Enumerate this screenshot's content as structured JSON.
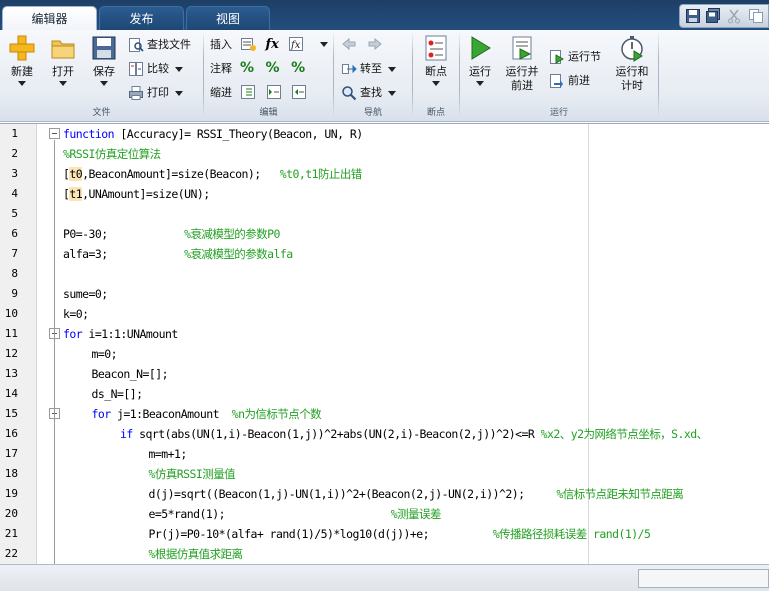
{
  "tabs": [
    {
      "label": "编辑器",
      "active": true
    },
    {
      "label": "发布",
      "active": false
    },
    {
      "label": "视图",
      "active": false
    }
  ],
  "quick_access": [
    "save-icon",
    "save-all-icon",
    "cut-icon",
    "copy-icon"
  ],
  "ribbon": {
    "file": {
      "label": "文件",
      "new": "新建",
      "open": "打开",
      "save": "保存",
      "find_files": "查找文件",
      "compare": "比较",
      "print": "打印"
    },
    "edit": {
      "label": "编辑",
      "insert": "插入",
      "comment": "注释",
      "indent": "缩进",
      "fx": "fx"
    },
    "navigate": {
      "label": "导航",
      "goto": "转至",
      "find": "查找"
    },
    "breakpoints": {
      "label": "断点",
      "breakpoints": "断点"
    },
    "run": {
      "label": "运行",
      "run": "运行",
      "run_advance_1": "运行并",
      "run_advance_2": "前进",
      "run_section": "运行节",
      "advance": "前进",
      "run_time_1": "运行和",
      "run_time_2": "计时"
    }
  },
  "accent_colors": {
    "tabbar": "#1d3f66",
    "keyword": "#0000ff",
    "comment": "#22a022",
    "highlight": "#fde4b5"
  },
  "code_lines": [
    {
      "n": "1",
      "fold": "box",
      "parts": [
        {
          "t": "function",
          "c": "kw"
        },
        {
          "t": " [Accuracy]= RSSI_Theory(Beacon, UN, R)"
        }
      ]
    },
    {
      "n": "2",
      "indent": 0,
      "parts": [
        {
          "t": "%RSSI仿真定位算法",
          "c": "cm"
        }
      ]
    },
    {
      "n": "3",
      "indent": 0,
      "parts": [
        {
          "t": "["
        },
        {
          "t": "t0",
          "c": "hl"
        },
        {
          "t": ",BeaconAmount]=size(Beacon);   "
        },
        {
          "t": "%t0,t1防止出错",
          "c": "cm"
        }
      ]
    },
    {
      "n": "4",
      "indent": 0,
      "parts": [
        {
          "t": "["
        },
        {
          "t": "t1",
          "c": "hl"
        },
        {
          "t": ",UNAmount]=size(UN);"
        }
      ]
    },
    {
      "n": "5",
      "indent": 0,
      "parts": []
    },
    {
      "n": "6",
      "indent": 0,
      "parts": [
        {
          "t": "P0=-30;            "
        },
        {
          "t": "%衰减模型的参数P0",
          "c": "cm"
        }
      ]
    },
    {
      "n": "7",
      "indent": 0,
      "parts": [
        {
          "t": "alfa=3;            "
        },
        {
          "t": "%衰减模型的参数alfa",
          "c": "cm"
        }
      ]
    },
    {
      "n": "8",
      "indent": 0,
      "parts": []
    },
    {
      "n": "9",
      "indent": 0,
      "parts": [
        {
          "t": "sume=0;"
        }
      ]
    },
    {
      "n": "10",
      "indent": 0,
      "parts": [
        {
          "t": "k=0;"
        }
      ]
    },
    {
      "n": "11",
      "fold": "box",
      "parts": [
        {
          "t": "for",
          "c": "kw"
        },
        {
          "t": " i=1:1:UNAmount"
        }
      ]
    },
    {
      "n": "12",
      "indent": 1,
      "parts": [
        {
          "t": "m=0;"
        }
      ]
    },
    {
      "n": "13",
      "indent": 1,
      "parts": [
        {
          "t": "Beacon_N=[];"
        }
      ]
    },
    {
      "n": "14",
      "indent": 1,
      "parts": [
        {
          "t": "ds_N=[];"
        }
      ]
    },
    {
      "n": "15",
      "fold": "box",
      "indent": 1,
      "parts": [
        {
          "t": "for",
          "c": "kw"
        },
        {
          "t": " j=1:BeaconAmount  "
        },
        {
          "t": "%n为信标节点个数",
          "c": "cm"
        }
      ]
    },
    {
      "n": "16",
      "indent": 2,
      "parts": [
        {
          "t": "if",
          "c": "kw"
        },
        {
          "t": " sqrt(abs(UN(1,i)-Beacon(1,j))^2+abs(UN(2,i)-Beacon(2,j))^2)<=R "
        },
        {
          "t": "%x2、y2为网络节点坐标，S.xd、",
          "c": "cm"
        }
      ]
    },
    {
      "n": "17",
      "indent": 3,
      "parts": [
        {
          "t": "m=m+1;"
        }
      ]
    },
    {
      "n": "18",
      "indent": 3,
      "parts": [
        {
          "t": "%仿真RSSI测量值",
          "c": "cm"
        }
      ]
    },
    {
      "n": "19",
      "indent": 3,
      "parts": [
        {
          "t": "d(j)=sqrt((Beacon(1,j)-UN(1,i))^2+(Beacon(2,j)-UN(2,i))^2);     "
        },
        {
          "t": "%信标节点距未知节点距离",
          "c": "cm"
        }
      ]
    },
    {
      "n": "20",
      "indent": 3,
      "parts": [
        {
          "t": "e=5*rand(1);                          "
        },
        {
          "t": "%测量误差",
          "c": "cm"
        }
      ]
    },
    {
      "n": "21",
      "indent": 3,
      "parts": [
        {
          "t": "Pr(j)=P0-10*(alfa+ rand(1)/5)*log10(d(j))+e;          "
        },
        {
          "t": "%传播路径损耗误差 rand(1)/5",
          "c": "cm"
        }
      ]
    },
    {
      "n": "22",
      "indent": 3,
      "parts": [
        {
          "t": "%根据仿真值求距离",
          "c": "cm"
        }
      ]
    }
  ]
}
